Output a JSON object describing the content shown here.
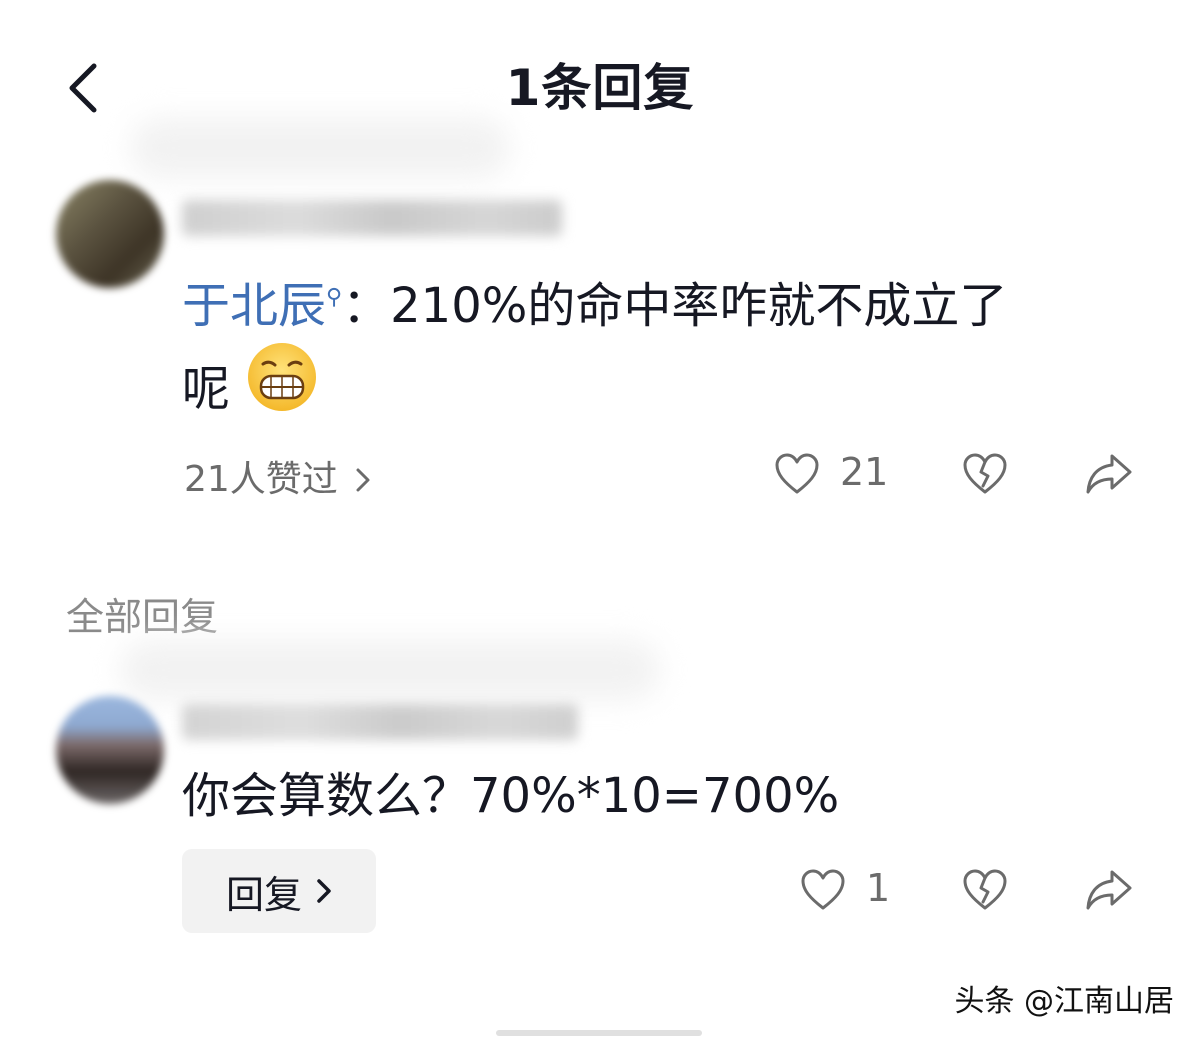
{
  "header": {
    "back_icon": "chevron-left-icon",
    "title": "1条回复"
  },
  "main_comment": {
    "mention": "于北辰",
    "text_line1": "：210%的命中率咋就不成立了",
    "text_line2": "呢",
    "emoji": "grinning-face-icon",
    "likes_text": "21人赞过",
    "like_count": "21"
  },
  "replies_section": {
    "title": "全部回复"
  },
  "reply": {
    "text": "你会算数么？70%*10=700%",
    "reply_button_label": "回复",
    "like_count": "1"
  },
  "watermark": "头条 @江南山居"
}
